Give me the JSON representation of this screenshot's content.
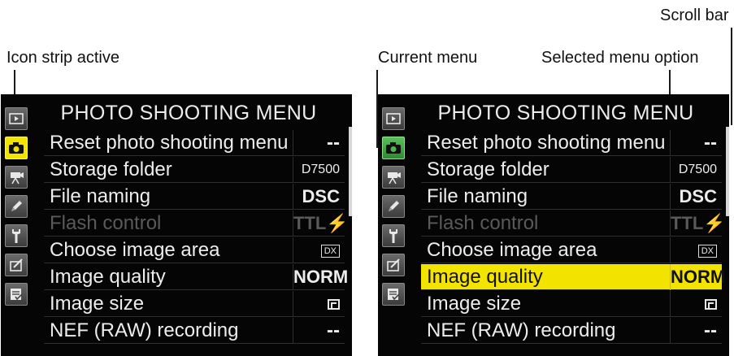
{
  "annotations": {
    "icon_strip_active": "Icon strip active",
    "current_menu": "Current menu",
    "selected_menu_option": "Selected menu option",
    "scroll_bar": "Scroll bar"
  },
  "menu": {
    "title": "PHOTO SHOOTING MENU",
    "strip_icons": [
      "playback-icon",
      "camera-icon",
      "movie-camera-icon",
      "pencil-icon",
      "wrench-icon",
      "retouch-icon",
      "my-menu-icon"
    ],
    "active_icon": "camera-icon",
    "items": [
      {
        "label": "Reset photo shooting menu",
        "value": "--"
      },
      {
        "label": "Storage folder",
        "value": "D7500"
      },
      {
        "label": "File naming",
        "value": "DSC"
      },
      {
        "label": "Flash control",
        "value": "TTL⚡"
      },
      {
        "label": "Choose image area",
        "value": "DX"
      },
      {
        "label": "Image quality",
        "value": "NORM"
      },
      {
        "label": "Image size",
        "value": ""
      },
      {
        "label": "NEF (RAW) recording",
        "value": "--"
      }
    ],
    "disabled_item": "Flash control",
    "selected_item": "Image quality",
    "colors": {
      "highlight": "#f3e400",
      "background": "#050505",
      "text": "#ededed"
    }
  }
}
